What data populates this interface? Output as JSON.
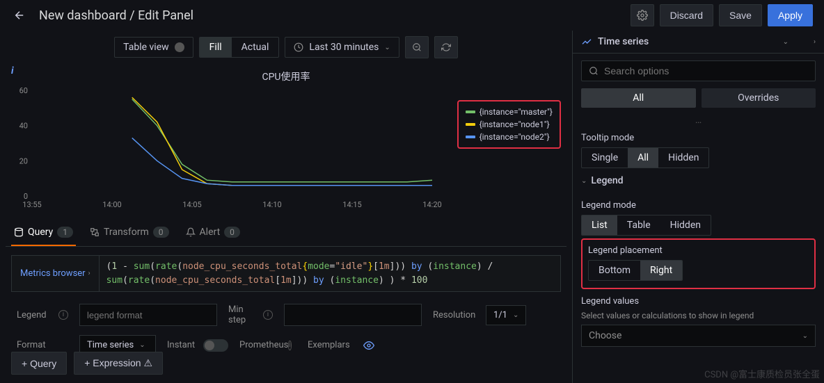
{
  "header": {
    "title": "New dashboard / Edit Panel",
    "discard": "Discard",
    "save": "Save",
    "apply": "Apply"
  },
  "viz_toolbar": {
    "table_view": "Table view",
    "fill": "Fill",
    "actual": "Actual",
    "time_range": "Last 30 minutes"
  },
  "chart_data": {
    "type": "line",
    "title": "CPU使用率",
    "xlabel": "",
    "ylabel": "",
    "ylim": [
      0,
      60
    ],
    "x_ticks": [
      "13:55",
      "14:00",
      "14:05",
      "14:10",
      "14:15",
      "14:20"
    ],
    "y_ticks": [
      0,
      20,
      40,
      60
    ],
    "series": [
      {
        "name": "{instance=\"master\"}",
        "color": "#73bf69",
        "values": [
          null,
          null,
          null,
          null,
          55,
          40,
          18,
          9,
          8,
          8,
          8,
          8,
          8,
          8,
          8,
          8,
          9
        ]
      },
      {
        "name": "{instance=\"node1\"}",
        "color": "#f2cc0c",
        "values": [
          null,
          null,
          null,
          null,
          56,
          42,
          15,
          7,
          6,
          6,
          6,
          6,
          6,
          6,
          6,
          6,
          6
        ]
      },
      {
        "name": "{instance=\"node2\"}",
        "color": "#5794f2",
        "values": [
          null,
          null,
          null,
          null,
          33,
          20,
          10,
          7,
          6,
          6,
          6,
          6,
          6,
          6,
          6,
          6,
          6
        ]
      }
    ]
  },
  "tabs": {
    "query": {
      "label": "Query",
      "count": "1"
    },
    "transform": {
      "label": "Transform",
      "count": "0"
    },
    "alert": {
      "label": "Alert",
      "count": "0"
    }
  },
  "query": {
    "metrics_browser": "Metrics browser",
    "expr_html": "<span class='tok-op'>(</span><span class='tok-num'>1</span> <span class='tok-op'>-</span> <span class='tok-fn'>sum</span><span class='tok-op'>(</span><span class='tok-fn'>rate</span><span class='tok-op'>(</span><span class='tok-met'>node_cpu_seconds_total</span><span class='tok-br'>{</span><span class='tok-lab'>mode</span><span class='tok-op'>=</span><span class='tok-str'>\"idle\"</span><span class='tok-br'>}</span><span class='tok-op'>[</span><span class='tok-dur'>1m</span><span class='tok-op'>]))</span> <span class='tok-kw'>by</span> <span class='tok-op'>(</span><span class='tok-lab'>instance</span><span class='tok-op'>)</span>  <span class='tok-op'>/</span><br><span class='tok-fn'>sum</span><span class='tok-op'>(</span><span class='tok-fn'>rate</span><span class='tok-op'>(</span><span class='tok-met'>node_cpu_seconds_total</span><span class='tok-op'>[</span><span class='tok-dur'>1m</span><span class='tok-op'>]))</span> <span class='tok-kw'>by</span> <span class='tok-op'>(</span><span class='tok-lab'>instance</span><span class='tok-op'>) )</span> <span class='tok-op'>*</span> <span class='tok-num'>100</span>",
    "legend_label": "Legend",
    "legend_placeholder": "legend format",
    "min_step_label": "Min step",
    "resolution_label": "Resolution",
    "resolution_value": "1/1",
    "format_label": "Format",
    "format_value": "Time series",
    "instant_label": "Instant",
    "prometheus_label": "Prometheus",
    "exemplars_label": "Exemplars",
    "add_query": "Query",
    "add_expression": "Expression"
  },
  "right": {
    "viz_type": "Time series",
    "search_placeholder": "Search options",
    "tab_all": "All",
    "tab_overrides": "Overrides",
    "tooltip": {
      "heading": "Tooltip mode",
      "single": "Single",
      "all": "All",
      "hidden": "Hidden"
    },
    "legend": {
      "heading": "Legend",
      "mode_label": "Legend mode",
      "mode_list": "List",
      "mode_table": "Table",
      "mode_hidden": "Hidden",
      "placement_label": "Legend placement",
      "placement_bottom": "Bottom",
      "placement_right": "Right",
      "values_label": "Legend values",
      "values_hint": "Select values or calculations to show in legend",
      "values_choose": "Choose"
    }
  },
  "watermark": "CSDN @富士康质检员张全蛋"
}
